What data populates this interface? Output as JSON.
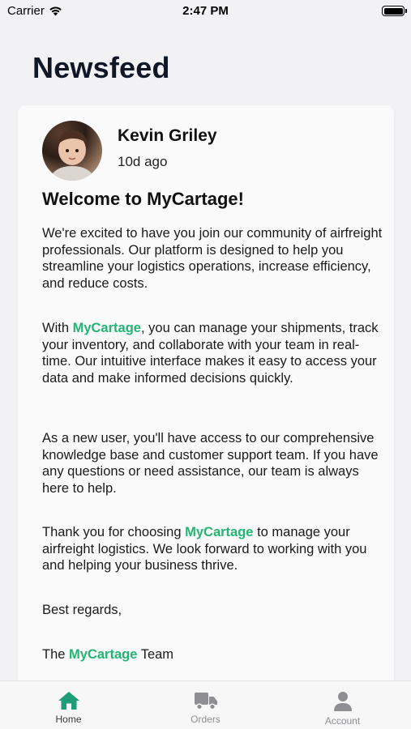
{
  "status": {
    "carrier": "Carrier",
    "time": "2:47 PM"
  },
  "page": {
    "title": "Newsfeed"
  },
  "post": {
    "author": "Kevin Griley",
    "time_ago": "10d ago",
    "title": "Welcome to MyCartage!",
    "p1": "We're excited to have you join our community of airfreight professionals. Our platform is designed to help you streamline your logistics operations, increase efficiency, and reduce costs.",
    "p2_pre": "With ",
    "p2_brand": "MyCartage",
    "p2_post": ", you can manage your shipments, track your inventory, and collaborate with your team in real-time. Our intuitive interface makes it easy to access your data and make informed decisions quickly.",
    "p3": "As a new user, you'll have access to our comprehensive knowledge base and customer support team. If you have any questions or need assistance, our team is always here to help.",
    "p4_pre": "Thank you for choosing ",
    "p4_brand": "MyCartage",
    "p4_post": " to manage your airfreight logistics. We look forward to working with you and helping your business thrive.",
    "p5": "Best regards,",
    "p6_pre": "The ",
    "p6_brand": "MyCartage",
    "p6_post": " Team"
  },
  "tabs": [
    {
      "label": "Home",
      "icon": "home-icon",
      "active": true
    },
    {
      "label": "Orders",
      "icon": "truck-icon",
      "active": false
    },
    {
      "label": "Account",
      "icon": "user-icon",
      "active": false
    }
  ],
  "colors": {
    "brand": "#22b573",
    "active_tab": "#1e9e78",
    "inactive_tab": "#8e8e93"
  }
}
